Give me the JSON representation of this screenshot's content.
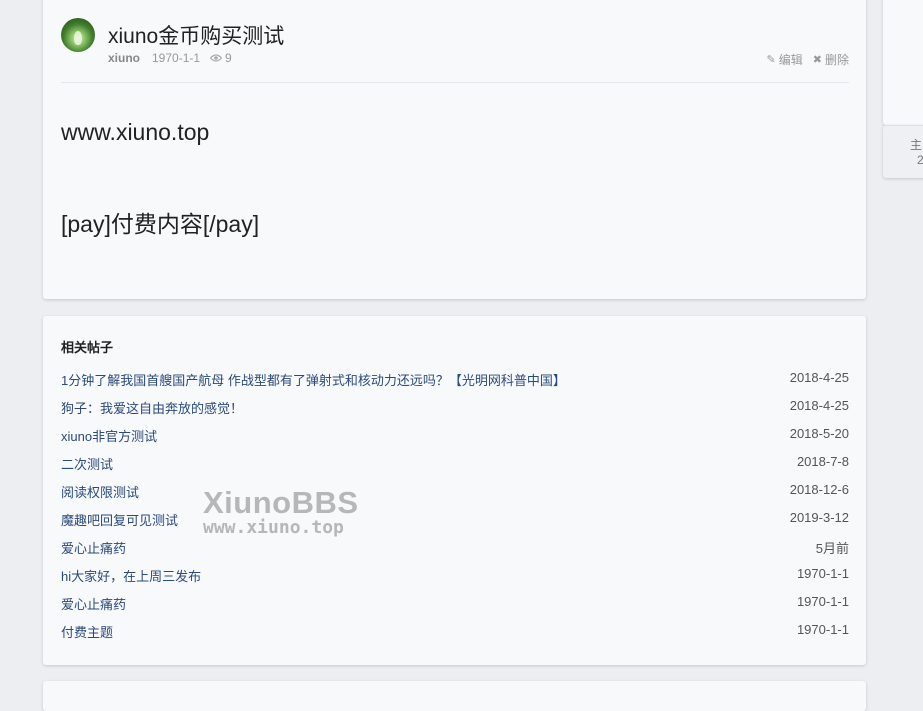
{
  "post": {
    "title": "xiuno金币购买测试",
    "author": "xiuno",
    "date": "1970-1-1",
    "views": "9",
    "edit_label": "编辑",
    "delete_label": "删除",
    "body_lines": [
      "www.xiuno.top",
      "[pay]付费内容[/pay]"
    ]
  },
  "related": {
    "title": "相关帖子",
    "items": [
      {
        "title": "1分钟了解我国首艘国产航母 作战型都有了弹射式和核动力还远吗？【光明网科普中国】",
        "date": "2018-4-25"
      },
      {
        "title": "狗子：我爱这自由奔放的感觉！",
        "date": "2018-4-25"
      },
      {
        "title": "xiuno非官方测试",
        "date": "2018-5-20"
      },
      {
        "title": "二次测试",
        "date": "2018-7-8"
      },
      {
        "title": "阅读权限测试",
        "date": "2018-12-6"
      },
      {
        "title": "魔趣吧回复可见测试",
        "date": "2019-3-12"
      },
      {
        "title": "爱心止痛药",
        "date": "5月前"
      },
      {
        "title": "hi大家好，在上周三发布",
        "date": "1970-1-1"
      },
      {
        "title": "爱心止痛药",
        "date": "1970-1-1"
      },
      {
        "title": "付费主题",
        "date": "1970-1-1"
      }
    ]
  },
  "sidebar": {
    "label_1": "主",
    "label_2": "2"
  },
  "watermark": {
    "line1": "XiunoBBS",
    "line2": "www.xiuno.top"
  }
}
